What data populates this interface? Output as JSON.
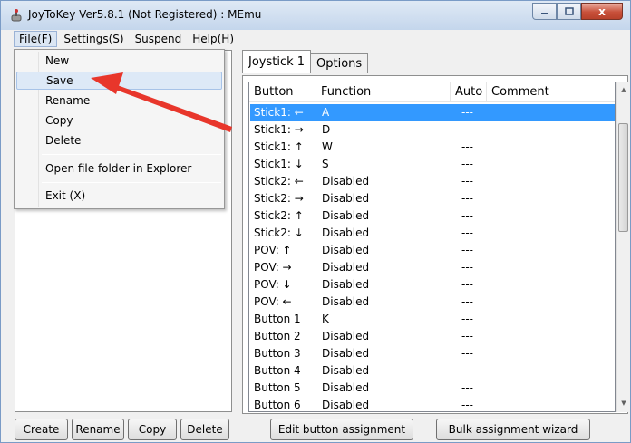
{
  "window": {
    "title": "JoyToKey Ver5.8.1 (Not Registered) : MEmu",
    "minimize_icon": "minimize-icon",
    "maximize_icon": "maximize-icon",
    "close_label": "x"
  },
  "menubar": {
    "items": [
      "File(F)",
      "Settings(S)",
      "Suspend",
      "Help(H)"
    ]
  },
  "file_menu": {
    "items": [
      "New",
      "Save",
      "Rename",
      "Copy",
      "Delete",
      "Open file folder in Explorer",
      "Exit (X)"
    ],
    "hovered": "Save"
  },
  "left_buttons": [
    "Create",
    "Rename",
    "Copy",
    "Delete"
  ],
  "tabs": [
    "Joystick 1",
    "Options"
  ],
  "grid": {
    "headers": [
      "Button",
      "Function",
      "Auto",
      "Comment"
    ],
    "rows": [
      {
        "button": "Stick1: ←",
        "function": "A",
        "auto": "---",
        "comment": ""
      },
      {
        "button": "Stick1: →",
        "function": "D",
        "auto": "---",
        "comment": ""
      },
      {
        "button": "Stick1: ↑",
        "function": "W",
        "auto": "---",
        "comment": ""
      },
      {
        "button": "Stick1: ↓",
        "function": "S",
        "auto": "---",
        "comment": ""
      },
      {
        "button": "Stick2: ←",
        "function": "Disabled",
        "auto": "---",
        "comment": ""
      },
      {
        "button": "Stick2: →",
        "function": "Disabled",
        "auto": "---",
        "comment": ""
      },
      {
        "button": "Stick2: ↑",
        "function": "Disabled",
        "auto": "---",
        "comment": ""
      },
      {
        "button": "Stick2: ↓",
        "function": "Disabled",
        "auto": "---",
        "comment": ""
      },
      {
        "button": "POV: ↑",
        "function": "Disabled",
        "auto": "---",
        "comment": ""
      },
      {
        "button": "POV: →",
        "function": "Disabled",
        "auto": "---",
        "comment": ""
      },
      {
        "button": "POV: ↓",
        "function": "Disabled",
        "auto": "---",
        "comment": ""
      },
      {
        "button": "POV: ←",
        "function": "Disabled",
        "auto": "---",
        "comment": ""
      },
      {
        "button": "Button 1",
        "function": "K",
        "auto": "---",
        "comment": ""
      },
      {
        "button": "Button 2",
        "function": "Disabled",
        "auto": "---",
        "comment": ""
      },
      {
        "button": "Button 3",
        "function": "Disabled",
        "auto": "---",
        "comment": ""
      },
      {
        "button": "Button 4",
        "function": "Disabled",
        "auto": "---",
        "comment": ""
      },
      {
        "button": "Button 5",
        "function": "Disabled",
        "auto": "---",
        "comment": ""
      },
      {
        "button": "Button 6",
        "function": "Disabled",
        "auto": "---",
        "comment": ""
      }
    ],
    "selected_row": 0
  },
  "bottom_buttons": [
    "Edit button assignment",
    "Bulk assignment wizard"
  ],
  "colors": {
    "selection": "#3399ff",
    "annotation_arrow": "#e8362b"
  }
}
